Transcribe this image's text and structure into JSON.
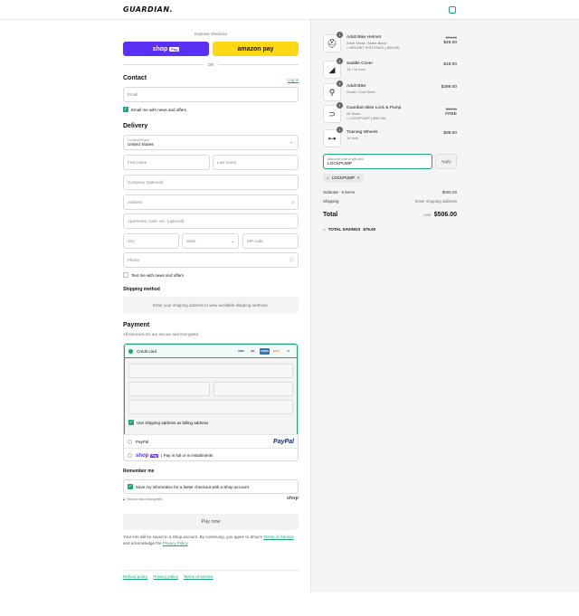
{
  "header": {
    "logo": "GUARDIAN."
  },
  "express": {
    "title": "Express checkout",
    "shop_label": "shop",
    "shop_pay": "Pay",
    "amazon_label": "amazon pay",
    "or": "OR"
  },
  "contact": {
    "title": "Contact",
    "login": "Log in",
    "email_placeholder": "Email",
    "news_label": "Email me with news and offers"
  },
  "delivery": {
    "title": "Delivery",
    "country_label": "Country/Region",
    "country_value": "United States",
    "first_name": "First name",
    "last_name": "Last name",
    "company": "Company (optional)",
    "address": "Address",
    "apartment": "Apartment, suite, etc. (optional)",
    "city": "City",
    "state": "State",
    "zip": "ZIP code",
    "phone": "Phone",
    "text_news": "Text me with news and offers"
  },
  "shipping": {
    "title": "Shipping method",
    "message": "Enter your shipping address to view available shipping methods."
  },
  "payment": {
    "title": "Payment",
    "subtitle": "All transactions are secure and encrypted.",
    "credit_card": "Credit card",
    "card_logos": [
      "VISA",
      "MC",
      "AMEX",
      "DISC",
      "+5"
    ],
    "billing_same": "Use shipping address as billing address",
    "paypal_label": "PayPal",
    "paypal_logo": "PayPal",
    "shoppay_logo": "shop",
    "shoppay_pay": "Pay",
    "shoppay_text": "| Pay in full or in installments"
  },
  "remember": {
    "title": "Remember me",
    "save_info": "Save my information for a faster checkout with a Shop account",
    "secure": "Secure and encrypted",
    "shop": "shop"
  },
  "pay_now": "Pay now",
  "terms": {
    "text1": "Your info will be saved to a Shop account. By continuing, you agree to Shop's",
    "tos": "Terms of Service",
    "text2": "and acknowledge the",
    "privacy": "Privacy Policy",
    "end": "."
  },
  "footer": [
    "Refund policy",
    "Privacy policy",
    "Terms of service"
  ],
  "order": {
    "items": [
      {
        "qty": "1",
        "name": "Adult Bike Helmet",
        "variant": "Adult Small / Matte Black",
        "discount": "HELMET WITH BIKE (-$25.00)",
        "orig": "$74.00",
        "price": "$49.00"
      },
      {
        "qty": "1",
        "name": "Saddle Cover",
        "variant": "14 / 16 Inch",
        "discount": "",
        "orig": "",
        "price": "$19.00"
      },
      {
        "qty": "1",
        "name": "Adult Bike",
        "variant": "Small / Cold Steel",
        "discount": "",
        "orig": "",
        "price": "$399.00"
      },
      {
        "qty": "1",
        "name": "Guardian Bike Lock & Pump",
        "variant": "All Sizes",
        "discount": "LOCKPUMP (-$50.00)",
        "orig": "$50.00",
        "price": "FREE"
      },
      {
        "qty": "1",
        "name": "Training Wheels",
        "variant": "14 Inch",
        "discount": "",
        "orig": "",
        "price": "$39.00"
      }
    ],
    "discount_placeholder": "Discount code or gift card",
    "discount_value": "LOCKPUMP",
    "apply": "Apply",
    "tag": "LOCKPUMP",
    "subtotal_label": "Subtotal · 5 items",
    "subtotal_value": "$506.00",
    "shipping_label": "Shipping",
    "shipping_value": "Enter shipping address",
    "total_label": "Total",
    "currency": "USD",
    "total_value": "$506.00",
    "savings_label": "TOTAL SAVINGS",
    "savings_value": "$75.00"
  },
  "colors": {
    "accent": "#1aa67a",
    "shop": "#5a31f4",
    "amazon": "#ffd814"
  }
}
